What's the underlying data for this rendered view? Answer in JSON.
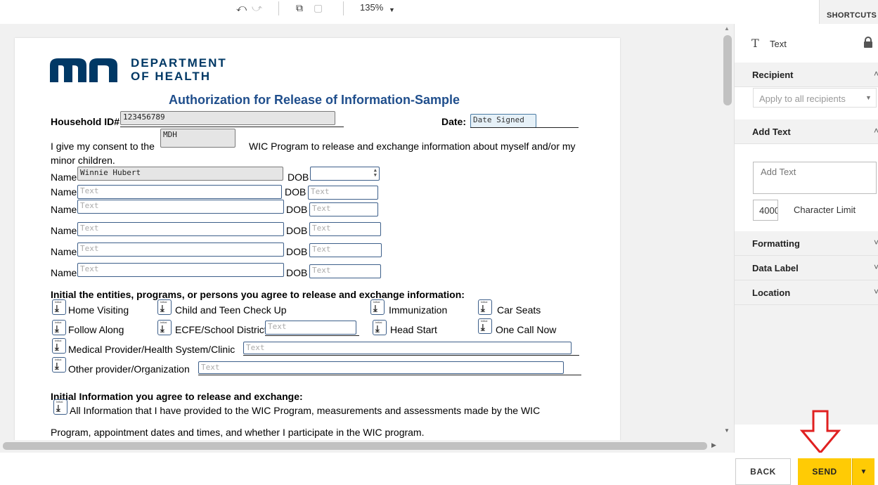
{
  "toolbar": {
    "undo_icon": "undo-icon",
    "redo_icon": "redo-icon",
    "zoom": "135%",
    "shortcuts_label": "SHORTCUTS"
  },
  "document": {
    "logo_line1": "DEPARTMENT",
    "logo_line2": "OF HEALTH",
    "title": "Authorization for Release of Information-Sample",
    "household_label": "Household ID#",
    "household_value": "123456789",
    "date_label": "Date:",
    "date_value": "Date Signed",
    "consent_prefix": "I give my consent to the",
    "consent_value": "MDH",
    "consent_suffix": "WIC Program to release and exchange information about myself and/or my",
    "consent_line2": "minor children.",
    "name_label": "Name",
    "dob_label": "DOB",
    "first_name_value": "Winnie Hubert",
    "field_placeholder": "Text",
    "entities_heading": "Initial the entities, programs, or persons you agree to release and exchange information:",
    "initial_label": "Initial",
    "entities": {
      "home_visiting": "Home Visiting",
      "child_teen": "Child and Teen Check Up",
      "immunization": "Immunization",
      "car_seats": "Car Seats",
      "follow_along": "Follow Along",
      "ecfe": "ECFE/School District",
      "head_start": "Head Start",
      "one_call": "One Call Now",
      "medical": "Medical Provider/Health System/Clinic",
      "other": "Other provider/Organization"
    },
    "info_heading": "Initial Information you agree to release and exchange:",
    "info_line1": "All Information that I have provided to the WIC Program, measurements and assessments made by the WIC",
    "info_line2": "Program, appointment dates and times, and whether I participate in the WIC program."
  },
  "panel": {
    "field_type": "Text",
    "lock_icon": "lock-icon",
    "recipient_title": "Recipient",
    "recipient_select": "Apply to all recipients",
    "add_text_title": "Add Text",
    "add_text_placeholder": "Add Text",
    "char_limit_value": "4000",
    "char_limit_label": "Character Limit",
    "formatting_title": "Formatting",
    "data_label_title": "Data Label",
    "location_title": "Location"
  },
  "footer": {
    "back_label": "BACK",
    "send_label": "SEND"
  },
  "colors": {
    "accent": "#ffcb05",
    "field_border": "#3d5f8a",
    "logo": "#003865",
    "annotation_arrow": "#e02020"
  }
}
